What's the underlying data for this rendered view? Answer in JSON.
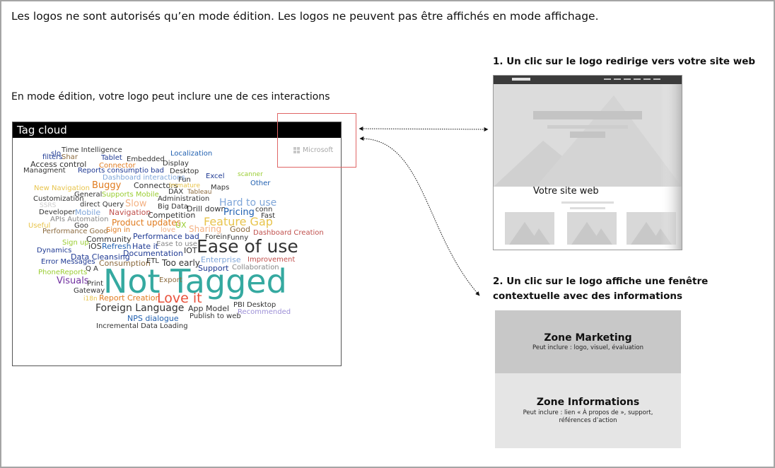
{
  "header_note": "Les logos ne sont autorisés qu’en mode édition. Les logos ne peuvent pas être affichés en mode affichage.",
  "edit_mode_note": "En mode édition, votre logo peut inclure une de ces interactions",
  "tag_cloud": {
    "title": "Tag cloud",
    "words": [
      {
        "t": "Time Intelligence",
        "c": "#333333"
      },
      {
        "t": "slo",
        "c": "#1f3a93"
      },
      {
        "t": "filters",
        "c": "#1f3a93"
      },
      {
        "t": "Shar",
        "c": "#8b6a3e"
      },
      {
        "t": "Tablet",
        "c": "#1f3a93"
      },
      {
        "t": "Embedded",
        "c": "#333333"
      },
      {
        "t": "Localization",
        "c": "#1f5fb0"
      },
      {
        "t": "Access control",
        "c": "#333333"
      },
      {
        "t": "Connector",
        "c": "#e07b1f"
      },
      {
        "t": "Display",
        "c": "#333333"
      },
      {
        "t": "Managment",
        "c": "#333333"
      },
      {
        "t": "Reports consumptio bad",
        "c": "#1f3a93"
      },
      {
        "t": "Desktop",
        "c": "#333333"
      },
      {
        "t": "Dashboard interactions",
        "c": "#7fa6d9"
      },
      {
        "t": "Excel",
        "c": "#1f3a93"
      },
      {
        "t": "scanner",
        "c": "#9acd32"
      },
      {
        "t": "Buggy",
        "c": "#e07b1f"
      },
      {
        "t": "Connectors",
        "c": "#333333"
      },
      {
        "t": "Immature",
        "c": "#e8c44c"
      },
      {
        "t": "Fun",
        "c": "#333333"
      },
      {
        "t": "Other",
        "c": "#1f5fb0"
      },
      {
        "t": "New Navigation",
        "c": "#e8c44c"
      },
      {
        "t": "Maps",
        "c": "#333333"
      },
      {
        "t": "DAX",
        "c": "#333333"
      },
      {
        "t": "Tableau",
        "c": "#8b6a3e"
      },
      {
        "t": "General",
        "c": "#333333"
      },
      {
        "t": "Supports Mobile",
        "c": "#9acd32"
      },
      {
        "t": "Customization",
        "c": "#333333"
      },
      {
        "t": "Administration",
        "c": "#333333"
      },
      {
        "t": "SSRS",
        "c": "#cccccc"
      },
      {
        "t": "direct Query",
        "c": "#333333"
      },
      {
        "t": "Slow",
        "c": "#f4b183"
      },
      {
        "t": "Hard to use",
        "c": "#7fa6d9"
      },
      {
        "t": "Big Data",
        "c": "#333333"
      },
      {
        "t": "Developer",
        "c": "#333333"
      },
      {
        "t": "Mobile",
        "c": "#7fa6d9"
      },
      {
        "t": "Navigation",
        "c": "#c0504d"
      },
      {
        "t": "Drill down",
        "c": "#333333"
      },
      {
        "t": "conn",
        "c": "#333333"
      },
      {
        "t": "Pricing",
        "c": "#1f5fb0"
      },
      {
        "t": "APIs Automation",
        "c": "#888888"
      },
      {
        "t": "Competition",
        "c": "#333333"
      },
      {
        "t": "Fast",
        "c": "#333333"
      },
      {
        "t": "Useful",
        "c": "#e8c44c"
      },
      {
        "t": "Goo",
        "c": "#333333"
      },
      {
        "t": "Product updates",
        "c": "#e07b1f"
      },
      {
        "t": "Feature Gap",
        "c": "#e8c44c"
      },
      {
        "t": "UX",
        "c": "#9acd32"
      },
      {
        "t": "Performance Good",
        "c": "#8b6a3e"
      },
      {
        "t": "Sign in",
        "c": "#e07b1f"
      },
      {
        "t": "love",
        "c": "#f4b183"
      },
      {
        "t": "Sharing",
        "c": "#f4b183"
      },
      {
        "t": "Good",
        "c": "#8b6a3e"
      },
      {
        "t": "Dashboard Creation",
        "c": "#c0504d"
      },
      {
        "t": "Community",
        "c": "#333333"
      },
      {
        "t": "Performance bad",
        "c": "#1f3a93"
      },
      {
        "t": "Forein",
        "c": "#333333"
      },
      {
        "t": "Funny",
        "c": "#333333"
      },
      {
        "t": "Sign up",
        "c": "#9acd32"
      },
      {
        "t": "iOS",
        "c": "#333333"
      },
      {
        "t": "Refresh",
        "c": "#1f5fb0"
      },
      {
        "t": "Hate it",
        "c": "#1f3a93"
      },
      {
        "t": "Ease to use",
        "c": "#888888"
      },
      {
        "t": "Ease of use",
        "c": "#333333"
      },
      {
        "t": "Dynamics",
        "c": "#1f3a93"
      },
      {
        "t": "Documentation",
        "c": "#1f3a93"
      },
      {
        "t": "IOT",
        "c": "#333333"
      },
      {
        "t": "Data Cleansing",
        "c": "#1f3a93"
      },
      {
        "t": "Enterprise",
        "c": "#7fa6d9"
      },
      {
        "t": "Error Messages",
        "c": "#1f3a93"
      },
      {
        "t": "Consumption",
        "c": "#8b6a3e"
      },
      {
        "t": "ETL",
        "c": "#333333"
      },
      {
        "t": "Too early",
        "c": "#333333"
      },
      {
        "t": "Improvement",
        "c": "#c0504d"
      },
      {
        "t": "Q A",
        "c": "#333333"
      },
      {
        "t": "Support",
        "c": "#1f3a93"
      },
      {
        "t": "Collaboration",
        "c": "#888888"
      },
      {
        "t": "PhoneReports",
        "c": "#9acd32"
      },
      {
        "t": "Not Tagged",
        "c": "#35a9a0"
      },
      {
        "t": "Visuals",
        "c": "#7030a0"
      },
      {
        "t": "Print",
        "c": "#333333"
      },
      {
        "t": "Export",
        "c": "#8b6a3e"
      },
      {
        "t": "Gateway",
        "c": "#333333"
      },
      {
        "t": "i18n",
        "c": "#e8c44c"
      },
      {
        "t": "Report Creation",
        "c": "#e07b1f"
      },
      {
        "t": "Love it",
        "c": "#e8503a"
      },
      {
        "t": "PBI Desktop",
        "c": "#333333"
      },
      {
        "t": "Foreign Language",
        "c": "#333333"
      },
      {
        "t": "App Model",
        "c": "#333333"
      },
      {
        "t": "Recommended",
        "c": "#9c8fd6"
      },
      {
        "t": "Publish to web",
        "c": "#333333"
      },
      {
        "t": "NPS dialogue",
        "c": "#1f5fb0"
      },
      {
        "t": "Incremental Data Loading",
        "c": "#333333"
      }
    ]
  },
  "logo": {
    "text": "Microsoft",
    "icon": "microsoft-logo-icon",
    "color": "#a8a8a8"
  },
  "option1": {
    "title": "1. Un clic sur le logo redirige vers votre site web",
    "site_label": "Votre site web"
  },
  "option2": {
    "title": "2. Un clic sur le logo affiche une fenêtre contextuelle avec des informations",
    "marketing": {
      "title": "Zone Marketing",
      "desc": "Peut inclure : logo, visuel, évaluation"
    },
    "info": {
      "title": "Zone Informations",
      "desc_line1": "Peut inclure : lien « À propos de », support,",
      "desc_line2": "références d’action"
    }
  },
  "colors": {
    "marketing_zone": "#c8c8c8",
    "info_zone": "#e5e5e5",
    "logo_highlight": "#e06666"
  }
}
